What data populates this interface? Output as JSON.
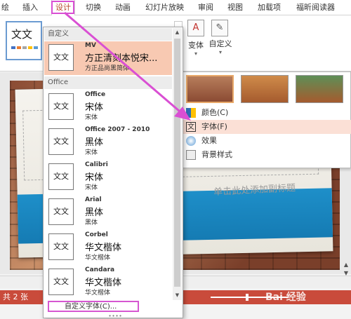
{
  "tabs": [
    "绘",
    "插入",
    "设计",
    "切换",
    "动画",
    "幻灯片放映",
    "审阅",
    "视图",
    "加载项",
    "福昕阅读器"
  ],
  "active_tab": "设计",
  "ribbon": {
    "theme_thumb_text": "文文",
    "variant_label": "变体",
    "custom_label": "自定义",
    "dropdown_glyph": "▾"
  },
  "variant_menu": {
    "items": [
      {
        "label": "颜色(C)",
        "icon": "palette-icon"
      },
      {
        "label": "字体(F)",
        "icon": "font-icon"
      },
      {
        "label": "效果",
        "icon": "effects-icon"
      },
      {
        "label": "背景样式",
        "icon": "background-style-icon"
      }
    ],
    "highlighted": "字体(F)"
  },
  "font_dropdown": {
    "sections": [
      "自定义",
      "Office"
    ],
    "icon_text": "文文",
    "custom_fonts": [
      {
        "name": "MV",
        "heading": "方正清刻本悦宋...",
        "body": "方正品尚黑简体"
      }
    ],
    "office_fonts": [
      {
        "name": "Office",
        "heading": "宋体",
        "body": "宋体"
      },
      {
        "name": "Office 2007 - 2010",
        "heading": "黑体",
        "body": "宋体"
      },
      {
        "name": "Calibri",
        "heading": "宋体",
        "body": "宋体"
      },
      {
        "name": "Arial",
        "heading": "黑体",
        "body": "黑体"
      },
      {
        "name": "Corbel",
        "heading": "华文楷体",
        "body": "华文楷体"
      },
      {
        "name": "Candara",
        "heading": "华文楷体",
        "body": "华文楷体"
      }
    ],
    "customize_button": "自定义字体(C)..."
  },
  "slide": {
    "subtitle_placeholder": "单击此处添加副标题"
  },
  "status": {
    "page_count": "共 2 张"
  },
  "watermark": "Bai 经验",
  "colors": {
    "accent": "#b7472a",
    "status_bar": "#c94b3b",
    "highlight": "#f8c9b2",
    "annotation": "#d94fd3"
  }
}
